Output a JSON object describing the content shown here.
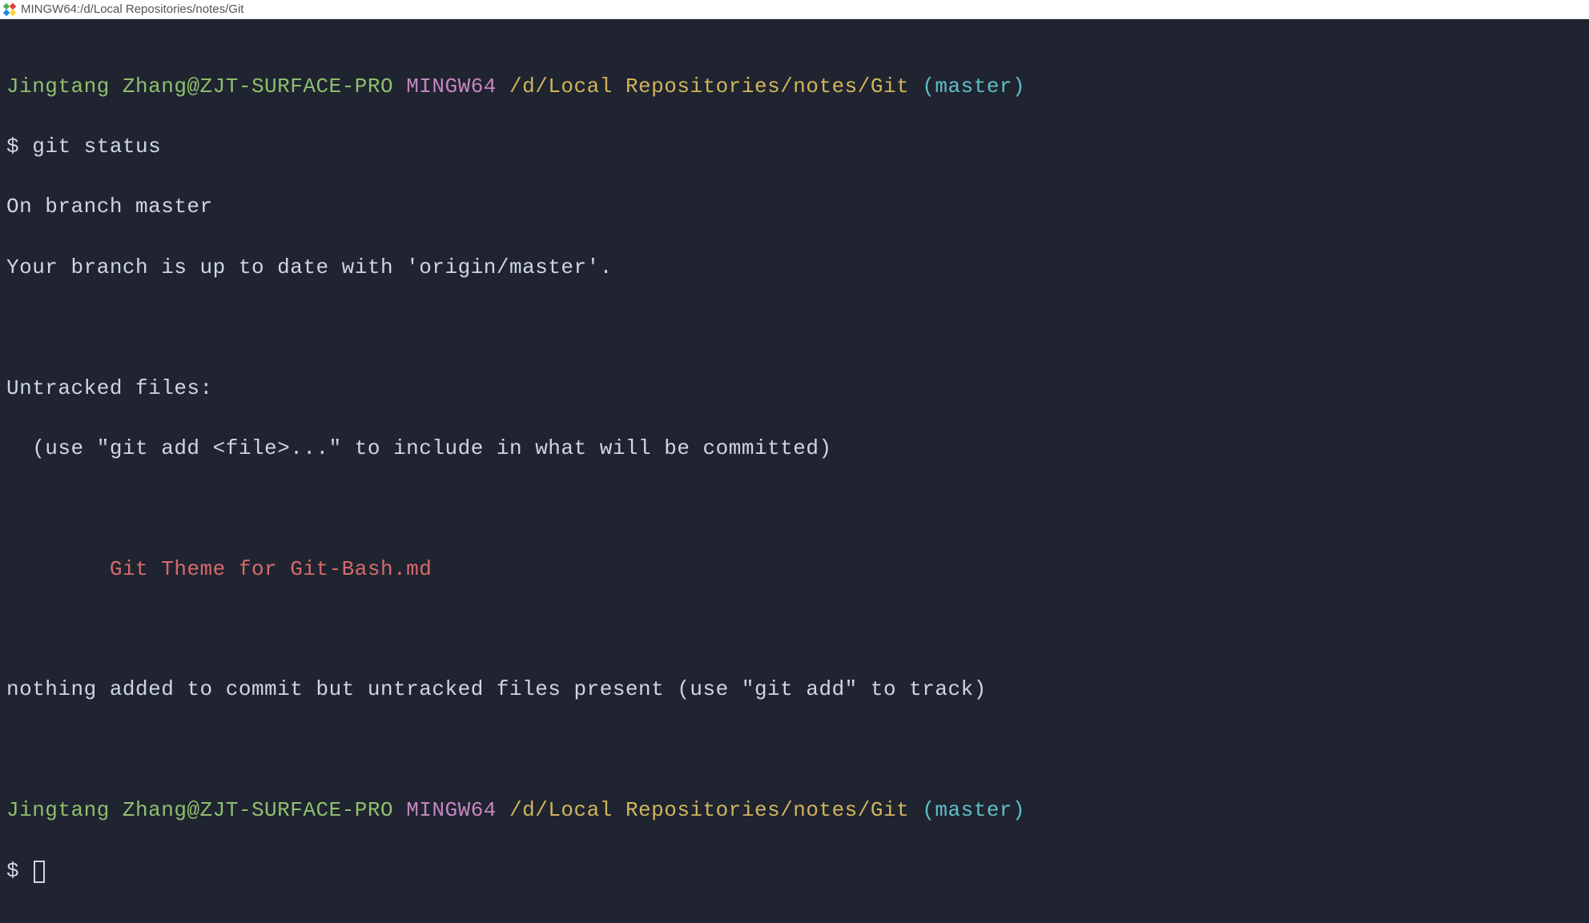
{
  "window": {
    "title": "MINGW64:/d/Local Repositories/notes/Git"
  },
  "prompt1": {
    "user": "Jingtang Zhang@ZJT-SURFACE-PRO",
    "host": "MINGW64",
    "path": "/d/Local Repositories/notes/Git",
    "branch": "(master)"
  },
  "command1": {
    "prompt_char": "$ ",
    "text": "git status"
  },
  "output": {
    "line1": "On branch master",
    "line2": "Your branch is up to date with 'origin/master'.",
    "line3": "Untracked files:",
    "line4": "  (use \"git add <file>...\" to include in what will be committed)",
    "untracked_indent": "        ",
    "untracked_file": "Git Theme for Git-Bash.md",
    "line5": "nothing added to commit but untracked files present (use \"git add\" to track)"
  },
  "prompt2": {
    "user": "Jingtang Zhang@ZJT-SURFACE-PRO",
    "host": "MINGW64",
    "path": "/d/Local Repositories/notes/Git",
    "branch": "(master)"
  },
  "command2": {
    "prompt_char": "$ "
  }
}
